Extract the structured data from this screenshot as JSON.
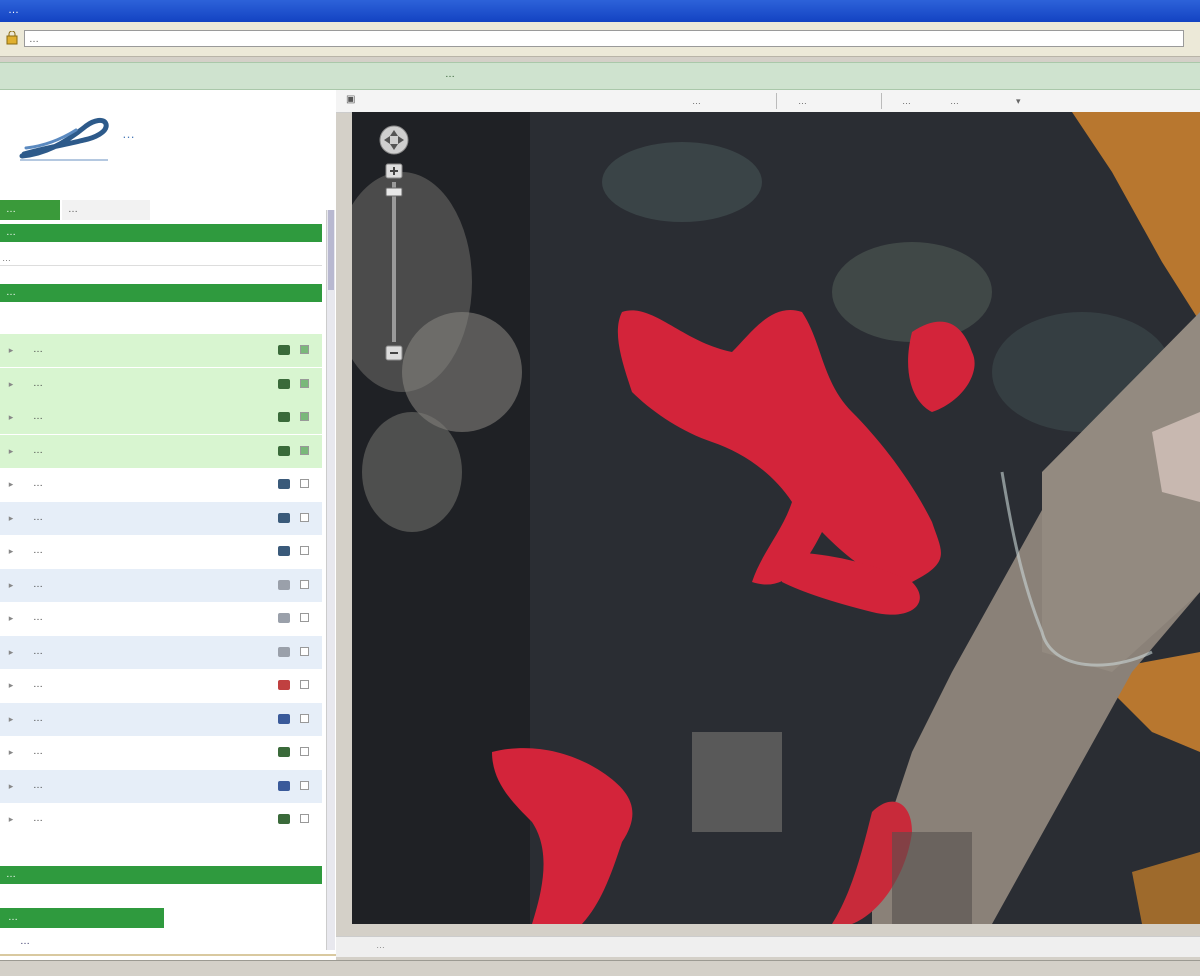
{
  "window": {
    "title": "…"
  },
  "address_bar": {
    "url": "…"
  },
  "banner": {
    "title": "…"
  },
  "sidebar": {
    "logo_text": "…",
    "tabs": [
      {
        "label": "…"
      },
      {
        "label": "…"
      }
    ],
    "section_header_1": "…",
    "section_subtitle": "…",
    "section_header_2": "…",
    "layers": [
      {
        "label": "…",
        "icon": "layer-icon",
        "color": "#3a6a3a",
        "checked": true
      },
      {
        "label": "…",
        "icon": "layer-icon",
        "color": "#3a6a3a",
        "checked": true
      },
      {
        "label": "…",
        "icon": "layer-icon",
        "color": "#3a6a3a",
        "checked": true
      },
      {
        "label": "…",
        "icon": "layer-icon",
        "color": "#3a6a3a",
        "checked": true
      },
      {
        "label": "…",
        "icon": "layer-icon",
        "color": "#3a5a7a",
        "checked": false
      },
      {
        "label": "…",
        "icon": "layer-icon",
        "color": "#3a5a7a",
        "checked": false
      },
      {
        "label": "…",
        "icon": "layer-icon",
        "color": "#3a5a7a",
        "checked": false
      },
      {
        "label": "…",
        "icon": "layer-icon",
        "color": "#9aa0aa",
        "checked": false
      },
      {
        "label": "…",
        "icon": "layer-icon",
        "color": "#9aa0aa",
        "checked": false
      },
      {
        "label": "…",
        "icon": "layer-icon",
        "color": "#9aa0aa",
        "checked": false
      },
      {
        "label": "…",
        "icon": "layer-icon",
        "color": "#c04040",
        "checked": false
      },
      {
        "label": "…",
        "icon": "layer-icon",
        "color": "#3a5a9a",
        "checked": false
      },
      {
        "label": "…",
        "icon": "layer-icon",
        "color": "#3a6a3a",
        "checked": false
      },
      {
        "label": "…",
        "icon": "layer-icon",
        "color": "#3a5a9a",
        "checked": false
      },
      {
        "label": "…",
        "icon": "layer-icon",
        "color": "#3a6a3a",
        "checked": false
      }
    ],
    "section_header_3": "…",
    "button_label": "…",
    "footer_link": "…"
  },
  "map_toolbar": {
    "coord_x": "…",
    "coord_y": "…",
    "scale_label": "…",
    "scale_value": "…"
  },
  "bottom_bar": {
    "text": "…"
  },
  "colors": {
    "accent_green": "#2f9a3e",
    "highlight_green": "#d8f5d0",
    "highlight_blue": "#e6eef8",
    "flood_red": "#d9263a",
    "soil_orange": "#c7843a"
  }
}
